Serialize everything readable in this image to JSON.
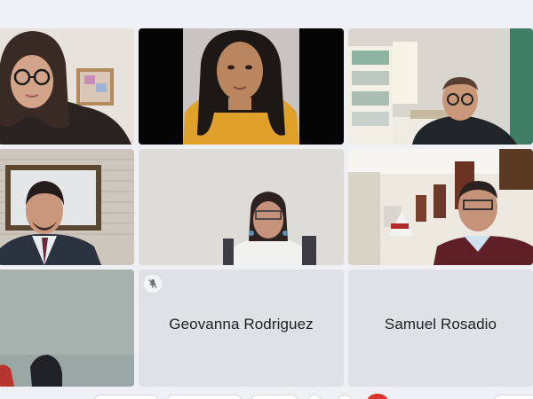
{
  "participants": [
    {
      "id": "p1"
    },
    {
      "id": "p2"
    },
    {
      "id": "p3"
    },
    {
      "id": "p4"
    },
    {
      "id": "p5"
    },
    {
      "id": "p6"
    },
    {
      "id": "p7"
    },
    {
      "name": "Geovanna Rodriguez",
      "muted_icon": "mic-off-icon"
    },
    {
      "name": "Samuel Rosadio"
    }
  ],
  "toolbar": {
    "leave_color": "#d9342b"
  }
}
